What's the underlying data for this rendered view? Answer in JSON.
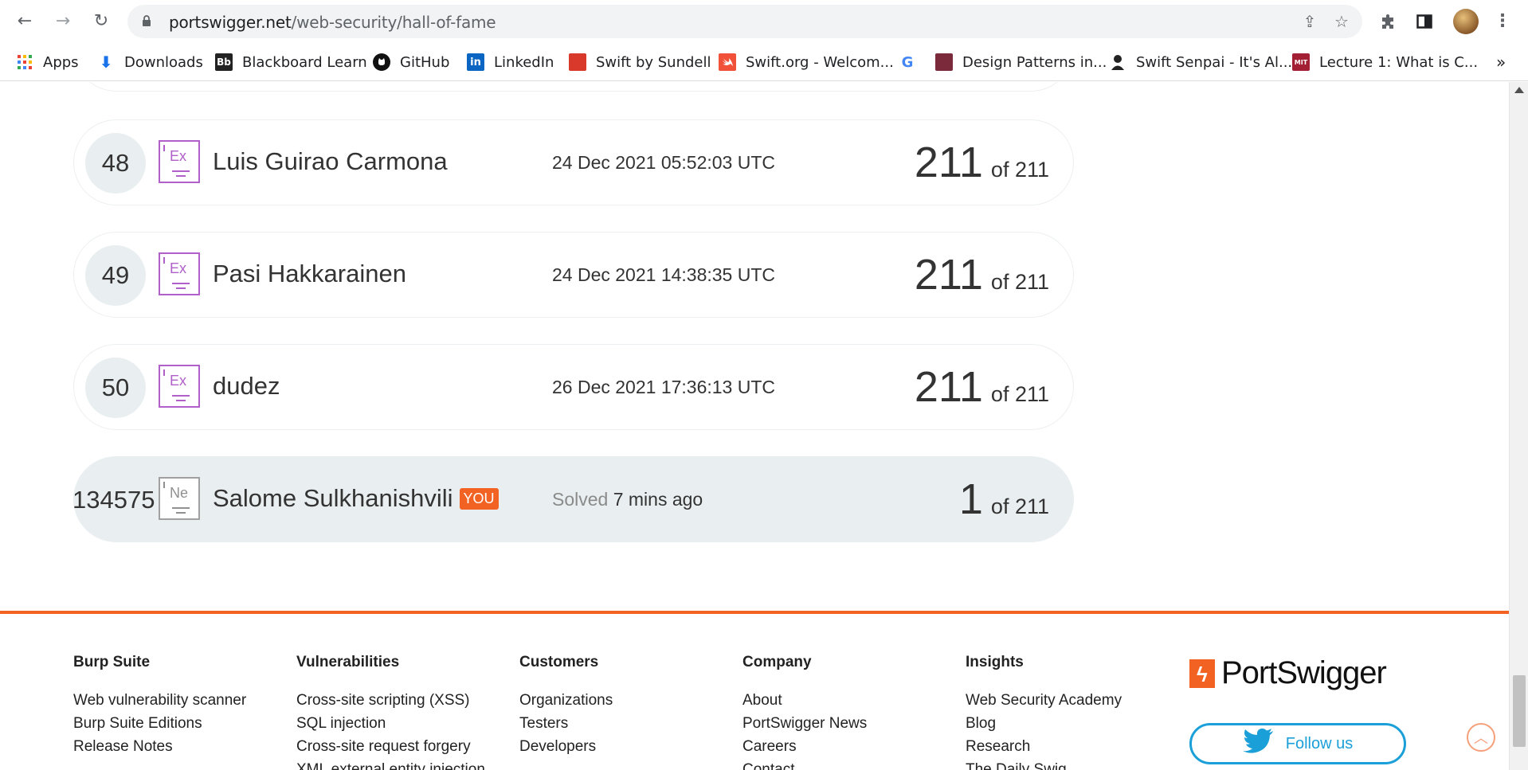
{
  "browser": {
    "url_host": "portswigger.net",
    "url_path": "/web-security/hall-of-fame"
  },
  "bookmarks": [
    {
      "label": "Apps"
    },
    {
      "label": "Downloads"
    },
    {
      "label": "Blackboard Learn",
      "icon_text": "Bb"
    },
    {
      "label": "GitHub"
    },
    {
      "label": "LinkedIn",
      "icon_text": "in"
    },
    {
      "label": "Swift by Sundell"
    },
    {
      "label": "Swift.org - Welcom..."
    },
    {
      "label": "",
      "icon_text": "G"
    },
    {
      "label": "Design Patterns in..."
    },
    {
      "label": "Swift Senpai - It's Al..."
    },
    {
      "label": "Lecture 1: What is C...",
      "icon_text": "MIT"
    }
  ],
  "bookmarks_overflow": "»",
  "leaderboard": [
    {
      "rank": "48",
      "badge": "Ex",
      "name": "Luis Guirao Carmona",
      "date": "24 Dec 2021 05:52:03 UTC",
      "score": "211",
      "total": "of 211"
    },
    {
      "rank": "49",
      "badge": "Ex",
      "name": "Pasi Hakkarainen",
      "date": "24 Dec 2021 14:38:35 UTC",
      "score": "211",
      "total": "of 211"
    },
    {
      "rank": "50",
      "badge": "Ex",
      "name": "dudez",
      "date": "26 Dec 2021 17:36:13 UTC",
      "score": "211",
      "total": "of 211"
    }
  ],
  "me": {
    "rank": "134575",
    "badge": "Ne",
    "name": "Salome Sulkhanishvili",
    "you_label": "YOU",
    "solved_label": "Solved",
    "solved_when": "7 mins ago",
    "score": "1",
    "total": "of 211"
  },
  "footer": {
    "columns": [
      {
        "title": "Burp Suite",
        "links": [
          "Web vulnerability scanner",
          "Burp Suite Editions",
          "Release Notes"
        ]
      },
      {
        "title": "Vulnerabilities",
        "links": [
          "Cross-site scripting (XSS)",
          "SQL injection",
          "Cross-site request forgery",
          "XML external entity injection"
        ]
      },
      {
        "title": "Customers",
        "links": [
          "Organizations",
          "Testers",
          "Developers"
        ]
      },
      {
        "title": "Company",
        "links": [
          "About",
          "PortSwigger News",
          "Careers",
          "Contact"
        ]
      },
      {
        "title": "Insights",
        "links": [
          "Web Security Academy",
          "Blog",
          "Research",
          "The Daily Swig"
        ]
      }
    ],
    "brand": "PortSwigger",
    "follow_label": "Follow us"
  },
  "colors": {
    "accent": "#f26222",
    "expert_badge": "#b060c8",
    "twitter": "#1b9fd8"
  }
}
